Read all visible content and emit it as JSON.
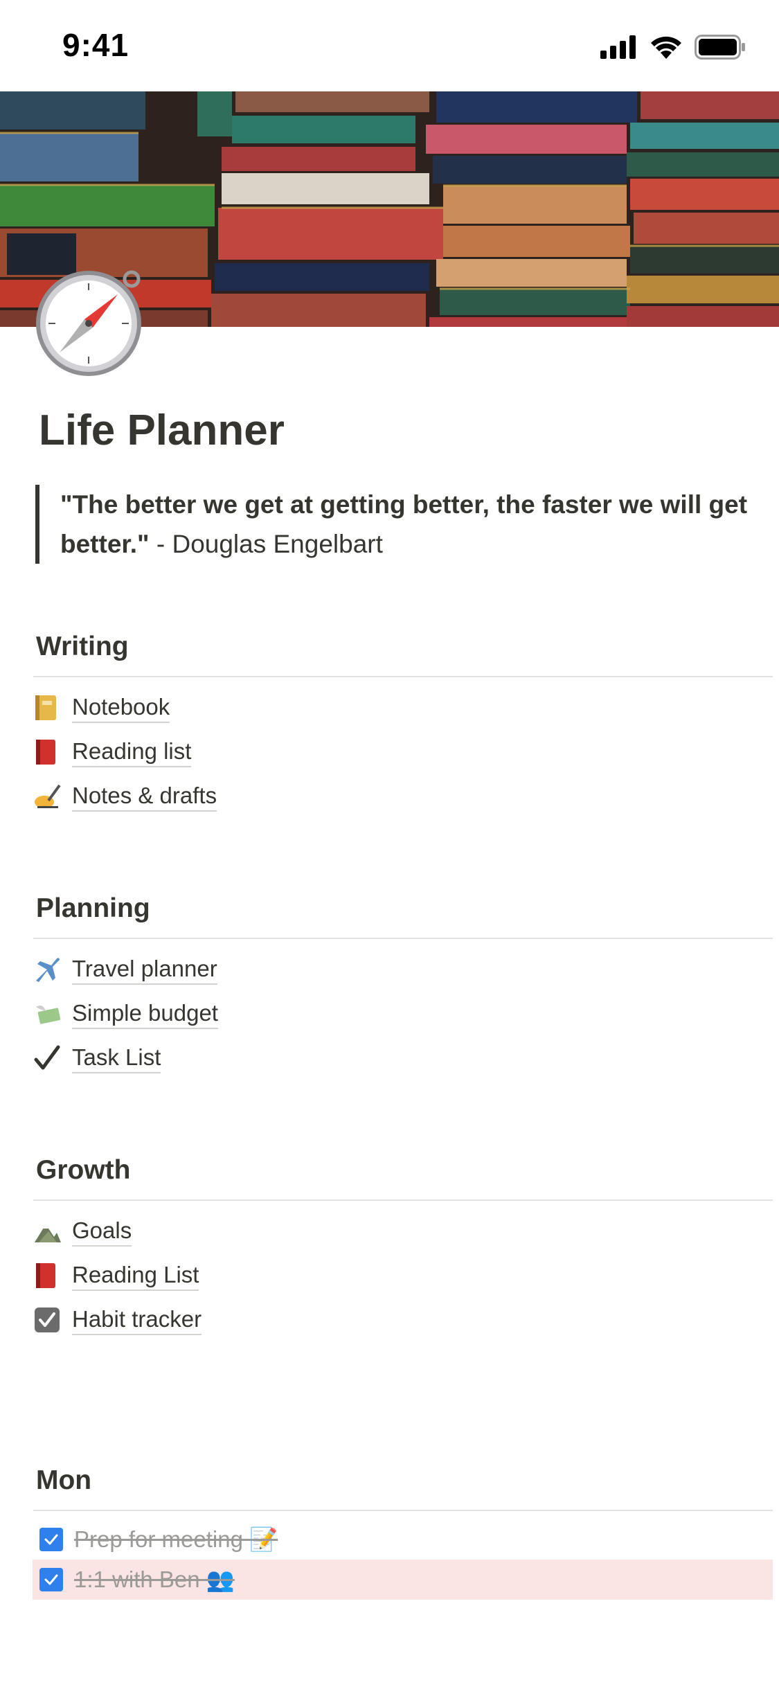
{
  "status": {
    "time": "9:41"
  },
  "page": {
    "title": "Life Planner",
    "quote_bold": "\"The better we get at getting better, the faster we will get better.\"",
    "quote_author": " - Douglas Engelbart"
  },
  "sections": {
    "writing": {
      "title": "Writing",
      "items": [
        {
          "label": "Notebook",
          "icon": "notebook-icon"
        },
        {
          "label": "Reading list",
          "icon": "red-book-icon"
        },
        {
          "label": "Notes & drafts",
          "icon": "writing-hand-icon"
        }
      ]
    },
    "planning": {
      "title": "Planning",
      "items": [
        {
          "label": "Travel planner",
          "icon": "airplane-icon"
        },
        {
          "label": "Simple budget",
          "icon": "money-wings-icon"
        },
        {
          "label": "Task List",
          "icon": "check-mark-icon"
        }
      ]
    },
    "growth": {
      "title": "Growth",
      "items": [
        {
          "label": "Goals",
          "icon": "mountain-icon"
        },
        {
          "label": "Reading List",
          "icon": "red-book-icon"
        },
        {
          "label": "Habit tracker",
          "icon": "checkbox-icon"
        }
      ]
    },
    "mon": {
      "title": "Mon",
      "todos": [
        {
          "text": "Prep for meeting 📝",
          "checked": true
        },
        {
          "text": "1:1 with Ben 👥",
          "checked": true
        }
      ]
    }
  },
  "colors": {
    "accent": "#2f80ed",
    "text": "#37352f",
    "highlight": "#fbe4e4"
  }
}
